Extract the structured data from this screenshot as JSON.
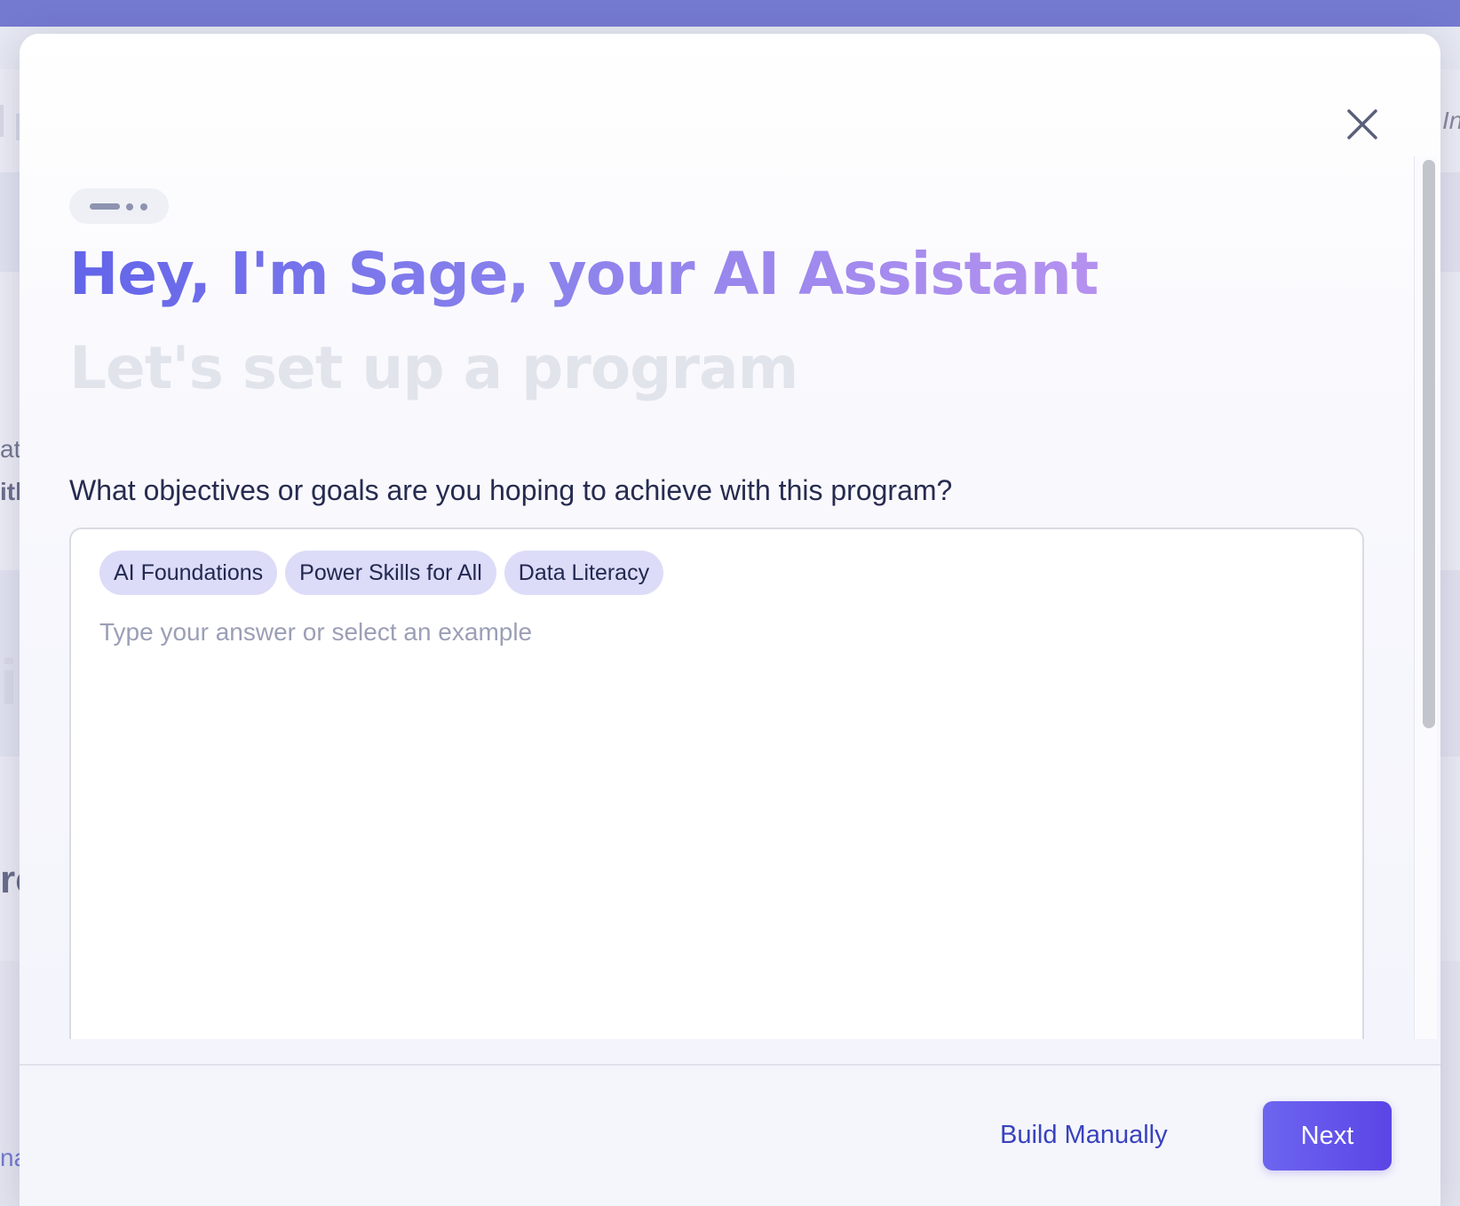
{
  "background": {
    "fragments": [
      "at",
      "itl",
      "i",
      "rc",
      "na",
      "In"
    ]
  },
  "modal": {
    "close_icon": "close-icon",
    "progress_icon": "progress-dots-icon",
    "title": "Hey, I'm Sage, your AI Assistant",
    "subtitle": "Let's set up a program",
    "question": "What objectives or goals are you hoping to achieve with this program?",
    "answer": {
      "placeholder": "Type your answer or select an example",
      "value": "",
      "examples": [
        "AI Foundations",
        "Power Skills for All",
        "Data Literacy"
      ]
    },
    "footer": {
      "build_manually_label": "Build Manually",
      "next_label": "Next"
    }
  },
  "colors": {
    "title_gradient_start": "#6264ea",
    "title_gradient_end": "#b591ef",
    "subtitle": "#e2e4ec",
    "chip_background": "#dcdcf8",
    "link": "#3942bd",
    "primary_button": "#5b45e6",
    "top_bar": "#3e46c2"
  }
}
